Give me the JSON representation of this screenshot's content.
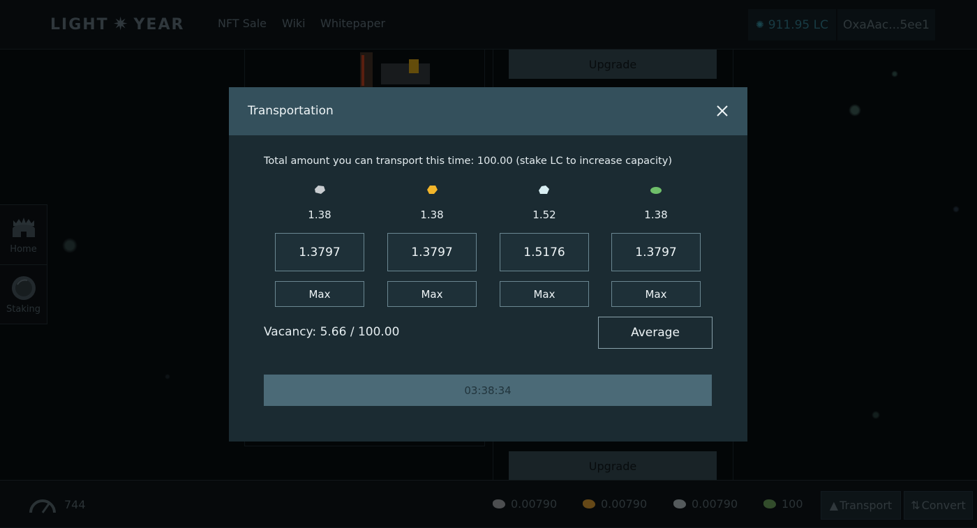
{
  "header": {
    "logo_left": "LIGHT",
    "logo_right": "YEAR",
    "nav": [
      "NFT Sale",
      "Wiki",
      "Whitepaper"
    ],
    "balance": "911.95 LC",
    "wallet": "OxaAac...5ee1"
  },
  "background": {
    "upgrade_top": "Upgrade",
    "upgrade_bottom": "Upgrade"
  },
  "sidebar": {
    "items": [
      {
        "label": "Home",
        "icon": "castle-icon"
      },
      {
        "label": "Staking",
        "icon": "planet-icon"
      }
    ]
  },
  "modal": {
    "title": "Transportation",
    "info": "Total amount you can transport this time: 100.00 (stake LC to increase capacity)",
    "resources": [
      {
        "icon": "iron-ore-icon",
        "color": "#c8ccd0",
        "amount": "1.38",
        "input": "1.3797",
        "max_label": "Max"
      },
      {
        "icon": "gold-ore-icon",
        "color": "#f2b52a",
        "amount": "1.38",
        "input": "1.3797",
        "max_label": "Max"
      },
      {
        "icon": "crystal-ore-icon",
        "color": "#d8eef2",
        "amount": "1.52",
        "input": "1.5176",
        "max_label": "Max"
      },
      {
        "icon": "green-ore-icon",
        "color": "#6fbf6a",
        "amount": "1.38",
        "input": "1.3797",
        "max_label": "Max"
      }
    ],
    "vacancy": "Vacancy: 5.66 / 100.00",
    "average_label": "Average",
    "timer": "03:38:34"
  },
  "bottombar": {
    "speed": "744",
    "resources": [
      {
        "icon": "iron-ore-icon",
        "color": "#8a8f93",
        "value": "0.00790"
      },
      {
        "icon": "gold-ore-icon",
        "color": "#b9832a",
        "value": "0.00790"
      },
      {
        "icon": "crystal-ore-icon",
        "color": "#9aa4a8",
        "value": "0.00790"
      },
      {
        "icon": "green-ore-icon",
        "color": "#5b8a4f",
        "value": "100"
      }
    ],
    "transport_label": "Transport",
    "convert_label": "Convert"
  }
}
